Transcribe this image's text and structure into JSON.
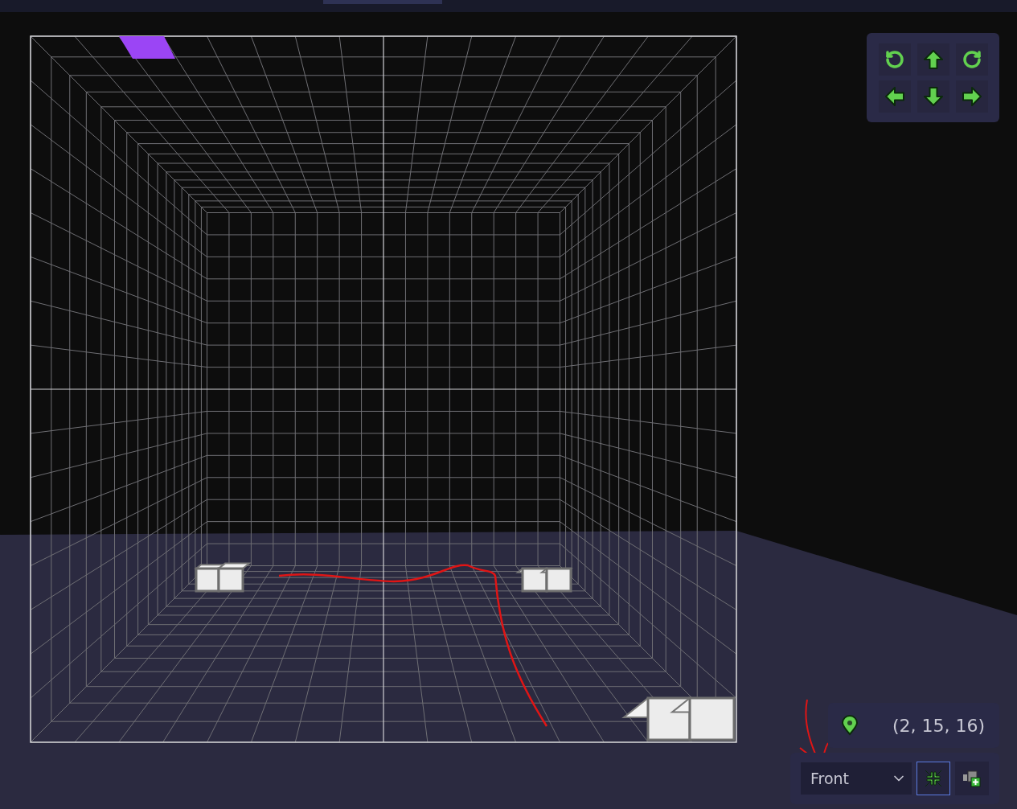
{
  "viewport": {
    "position": {
      "text": "(2, 15, 16)"
    },
    "view_select": {
      "value": "Front"
    },
    "toolbar_buttons": [
      {
        "kind": "fit",
        "selected": true
      },
      {
        "kind": "add-camera",
        "selected": false
      }
    ]
  }
}
